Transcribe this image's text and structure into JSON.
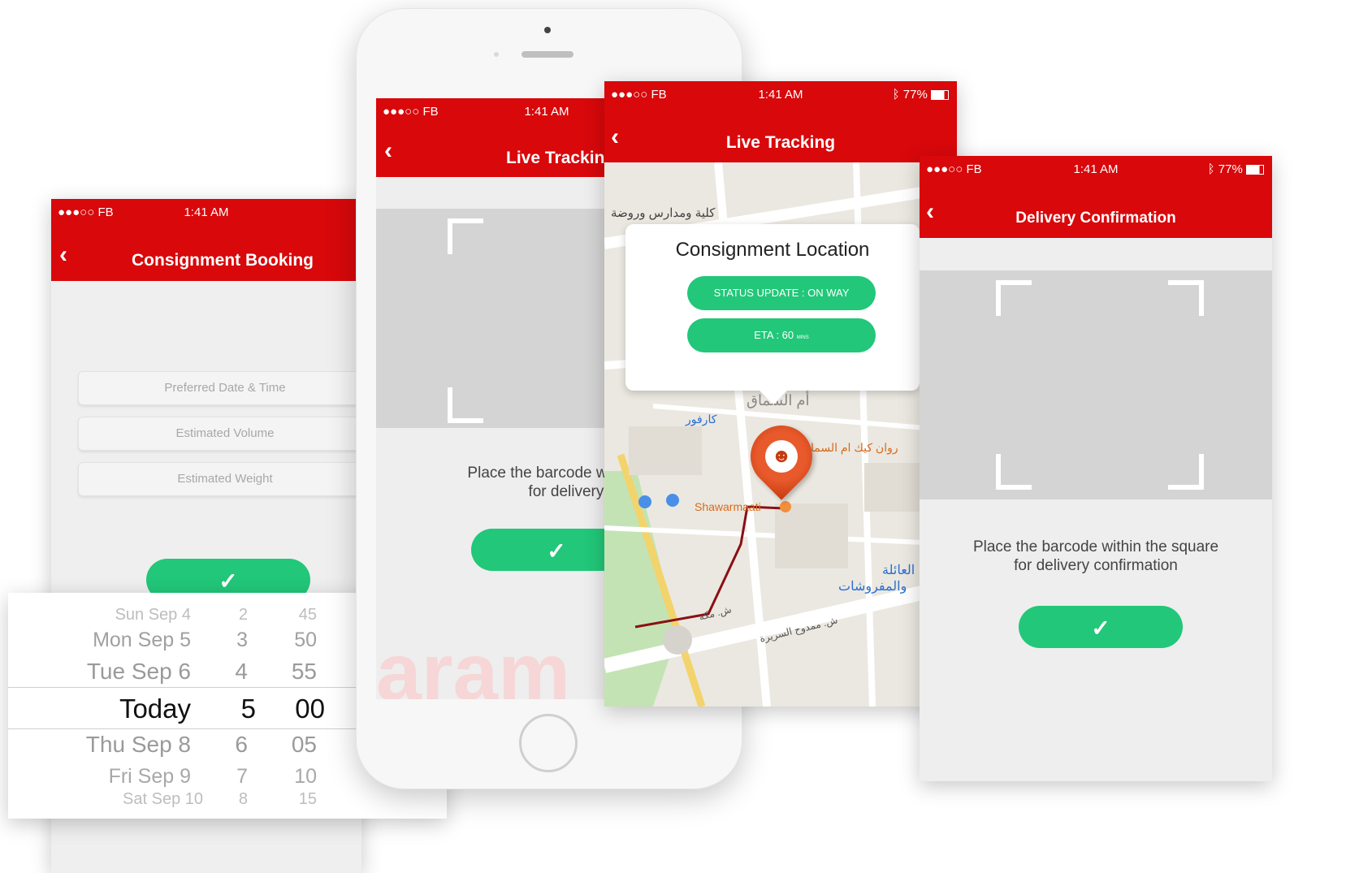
{
  "status": {
    "carrier": "●●●○○ FB",
    "wifi_icon": "wifi-icon",
    "time": "1:41 AM",
    "battery": "77%"
  },
  "colors": {
    "brand_red": "#d8080b",
    "accent_green": "#22c779",
    "scanner_gray": "#d4d4d4"
  },
  "booking": {
    "title": "Consignment Booking",
    "date_placeholder": "Preferred Date & Time",
    "volume_placeholder": "Estimated Volume",
    "weight_placeholder": "Estimated Weight",
    "confirm": "✓"
  },
  "picker": {
    "rows": [
      {
        "day": "Sun Sep 4",
        "hour": "2",
        "min": "45"
      },
      {
        "day": "Mon Sep 5",
        "hour": "3",
        "min": "50"
      },
      {
        "day": "Tue Sep 6",
        "hour": "4",
        "min": "55"
      },
      {
        "day": "Today",
        "hour": "5",
        "min": "00"
      },
      {
        "day": "Thu Sep 8",
        "hour": "6",
        "min": "05"
      },
      {
        "day": "Fri Sep 9",
        "hour": "7",
        "min": "10"
      },
      {
        "day": "Sat Sep 10",
        "hour": "8",
        "min": "15"
      }
    ]
  },
  "scan_status": {
    "title": "Live Tracking",
    "instruction_line1": "Place the barcode within t",
    "instruction_line2": "for delivery Statu",
    "confirm": "✓",
    "watermark": "aram"
  },
  "tracking": {
    "title": "Live Tracking",
    "card_title": "Consignment Location",
    "status_button": "STATUS UPDATE : ON WAY",
    "eta_button": "ETA : 60",
    "eta_unit": "MINS",
    "map_labels": [
      "كلية ومدارس وروضة",
      "أم السماق",
      "كارفور",
      "روان كيك ام السما",
      "Shawarmaati",
      "العائلة",
      "والمفروشات",
      "ش. ممدوح السريرة",
      "ش. مكة"
    ]
  },
  "confirmation": {
    "title": "Delivery Confirmation",
    "instruction_line1": "Place the barcode within the square",
    "instruction_line2": "for delivery confirmation",
    "confirm": "✓"
  }
}
